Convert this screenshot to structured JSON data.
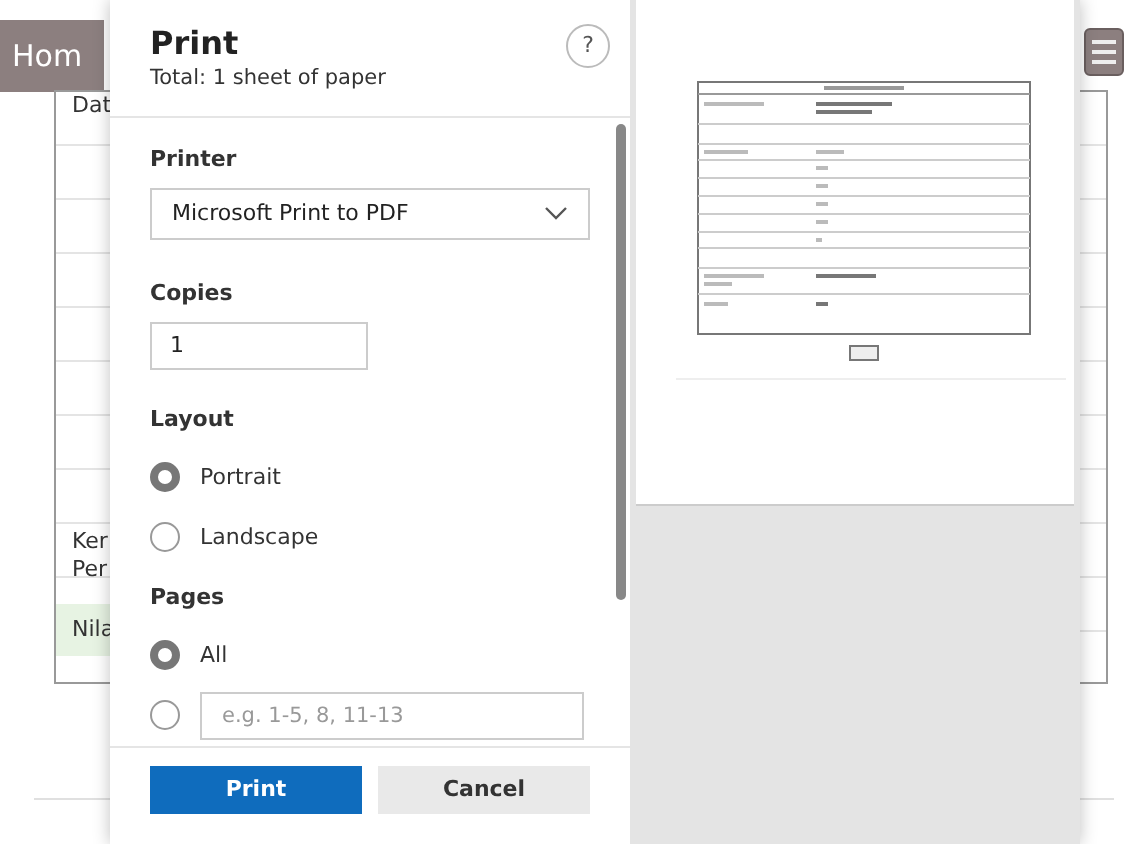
{
  "background_page": {
    "home_button": "Hom",
    "cells": [
      {
        "text": "Dat",
        "kind": "plain"
      },
      {
        "text": "Ker\nPer",
        "kind": "plain"
      },
      {
        "text": "Nila",
        "kind": "highlight"
      }
    ]
  },
  "print_dialog": {
    "title": "Print",
    "subtitle": "Total: 1 sheet of paper",
    "help": "?",
    "printer": {
      "label": "Printer",
      "value": "Microsoft Print to PDF"
    },
    "copies": {
      "label": "Copies",
      "value": "1"
    },
    "layout": {
      "label": "Layout",
      "options": [
        {
          "label": "Portrait",
          "selected": true
        },
        {
          "label": "Landscape",
          "selected": false
        }
      ]
    },
    "pages": {
      "label": "Pages",
      "options": [
        {
          "kind": "all",
          "label": "All",
          "selected": true
        },
        {
          "kind": "range",
          "placeholder": "e.g. 1-5, 8, 11-13",
          "selected": false
        }
      ]
    },
    "buttons": [
      {
        "label": "Print",
        "kind": "primary"
      },
      {
        "label": "Cancel",
        "kind": "secondary"
      }
    ]
  }
}
